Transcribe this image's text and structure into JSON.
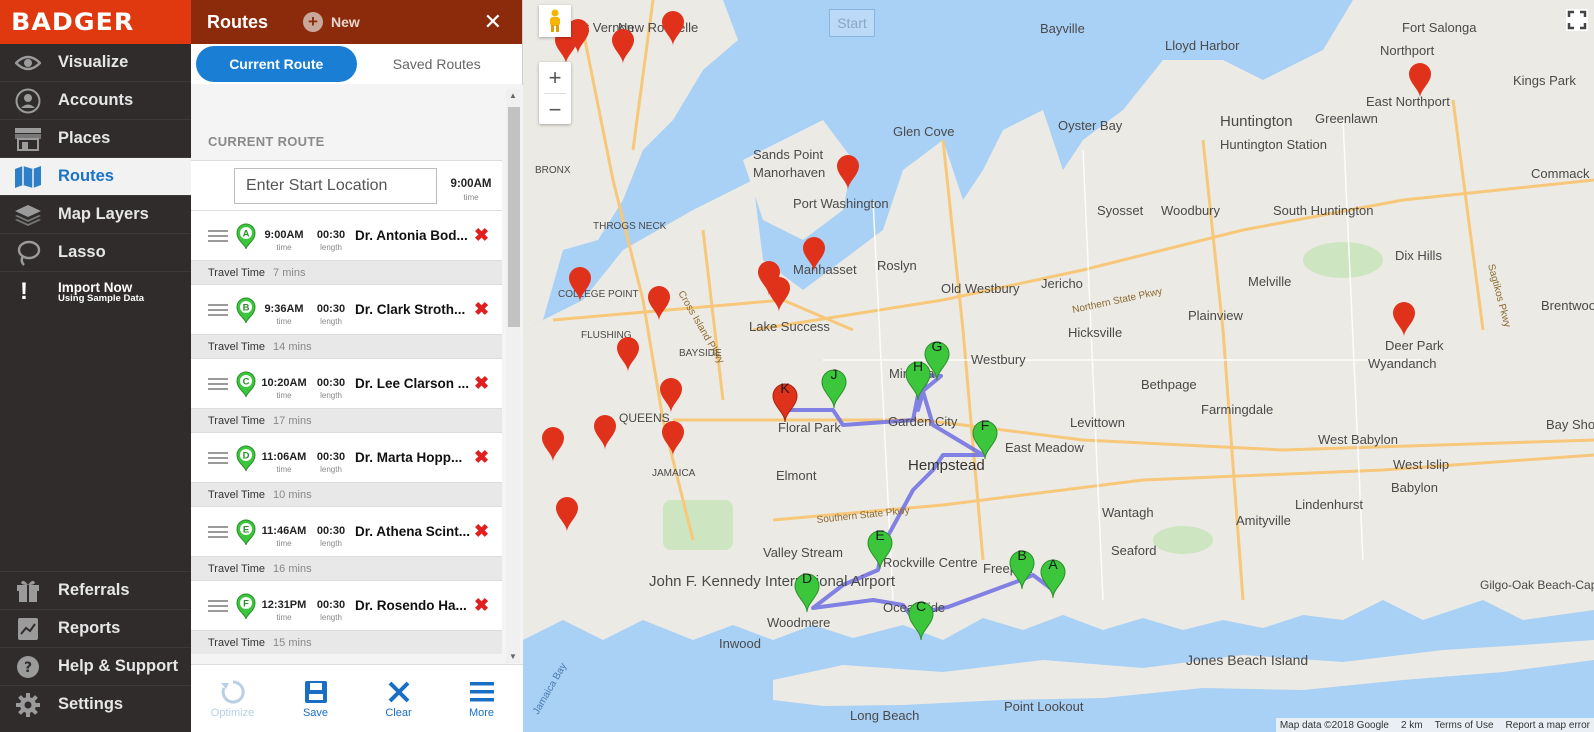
{
  "app": {
    "logo": "BADGER"
  },
  "sidebar": {
    "items": [
      {
        "label": "Visualize",
        "icon": "eye-icon"
      },
      {
        "label": "Accounts",
        "icon": "user-icon"
      },
      {
        "label": "Places",
        "icon": "store-icon"
      },
      {
        "label": "Routes",
        "icon": "map-icon",
        "active": true
      },
      {
        "label": "Map Layers",
        "icon": "layers-icon"
      },
      {
        "label": "Lasso",
        "icon": "lasso-icon"
      }
    ],
    "import": {
      "title": "Import Now",
      "subtitle": "Using Sample Data"
    },
    "bottom_items": [
      {
        "label": "Referrals",
        "icon": "gift-icon"
      },
      {
        "label": "Reports",
        "icon": "reports-icon"
      },
      {
        "label": "Help & Support",
        "icon": "help-icon"
      },
      {
        "label": "Settings",
        "icon": "gear-icon"
      }
    ]
  },
  "panel": {
    "title": "Routes",
    "new_label": "New",
    "close": "✕",
    "tabs": {
      "current": "Current Route",
      "saved": "Saved Routes"
    },
    "section_label": "CURRENT ROUTE",
    "start": {
      "placeholder": "Enter Start Location",
      "time": "9:00AM",
      "time_sub": "time"
    },
    "stops": [
      {
        "letter": "A",
        "time": "9:00AM",
        "length": "00:30",
        "name": "Dr. Antonia Bod...",
        "travel": "7 mins"
      },
      {
        "letter": "B",
        "time": "9:36AM",
        "length": "00:30",
        "name": "Dr. Clark Stroth...",
        "travel": "14 mins"
      },
      {
        "letter": "C",
        "time": "10:20AM",
        "length": "00:30",
        "name": "Dr. Lee Clarson ...",
        "travel": "17 mins"
      },
      {
        "letter": "D",
        "time": "11:06AM",
        "length": "00:30",
        "name": "Dr. Marta Hopp...",
        "travel": "10 mins"
      },
      {
        "letter": "E",
        "time": "11:46AM",
        "length": "00:30",
        "name": "Dr. Athena Scint...",
        "travel": "16 mins"
      },
      {
        "letter": "F",
        "time": "12:31PM",
        "length": "00:30",
        "name": "Dr. Rosendo Ha...",
        "travel": "15 mins"
      }
    ],
    "time_sub": "time",
    "length_sub": "length",
    "travel_label": "Travel Time",
    "toolbar": {
      "optimize": "Optimize",
      "save": "Save",
      "clear": "Clear",
      "more": "More"
    }
  },
  "map": {
    "start_overlay": "Start",
    "zoom_in": "+",
    "zoom_out": "−",
    "attribution": {
      "data": "Map data ©2018 Google",
      "scale": "2 km",
      "terms": "Terms of Use",
      "report": "Report a map error"
    },
    "place_labels": [
      "Mount Vernon",
      "New Rochelle",
      "Bayville",
      "Lloyd Harbor",
      "Fort Salonga",
      "Northport",
      "Kings Park",
      "East Northport",
      "Huntington",
      "Greenlawn",
      "Oyster Bay",
      "Glen Cove",
      "Sands Point",
      "Manorhaven",
      "Huntington Station",
      "Commack",
      "Port Washington",
      "Syosset",
      "Woodbury",
      "South Huntington",
      "Manhasset",
      "Roslyn",
      "Jericho",
      "Melville",
      "Dix Hills",
      "Old Westbury",
      "Northern State Pkwy",
      "Brentwood",
      "Lake Success",
      "Hicksville",
      "Plainview",
      "Deer Park",
      "Wyandanch",
      "Westbury",
      "Mineola",
      "Bethpage",
      "Farmingdale",
      "Garden City",
      "Levittown",
      "Floral Park",
      "West Babylon",
      "Hempstead",
      "East Meadow",
      "Bay Shore",
      "West Islip",
      "Elmont",
      "Babylon",
      "Lindenhurst",
      "Wantagh",
      "Southern State Pkwy",
      "John F. Kennedy International Airport",
      "Amityville",
      "Valley Stream",
      "Rockville Centre",
      "Freeport",
      "Seaford",
      "Gilgo-Oak Beach-Captree",
      "Woodmere",
      "Oceanside",
      "Inwood",
      "Jones Beach Island",
      "Point Lookout",
      "Long Beach",
      "BRONX",
      "THROGS NECK",
      "COLLEGE POINT",
      "FLUSHING",
      "BAYSIDE",
      "QUEENS",
      "JAMAICA",
      "Cross Island Pkwy",
      "Sagtikos Pkwy",
      "Jamaica Bay"
    ],
    "route_pins": [
      "A",
      "B",
      "C",
      "D",
      "E",
      "F",
      "G",
      "H",
      "J",
      "K"
    ],
    "colors": {
      "water": "#a9d0f5",
      "land": "#eceae4",
      "route": "#6e6de3",
      "pin_green": "#3cc63c",
      "pin_red": "#e0321b"
    }
  }
}
